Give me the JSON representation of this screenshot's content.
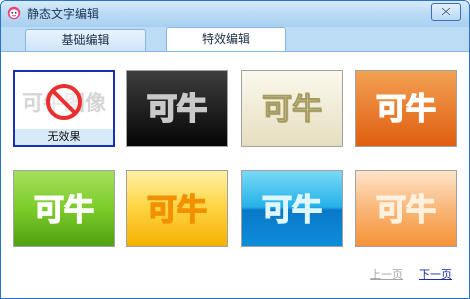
{
  "window": {
    "title": "静态文字编辑"
  },
  "tabs": [
    {
      "label": "基础编辑",
      "active": false
    },
    {
      "label": "特效编辑",
      "active": true
    }
  ],
  "effects": {
    "sample_text": "可牛",
    "noeffect_text": "可牛图像",
    "noeffect_label": "无效果",
    "items": [
      {
        "name": "no-effect",
        "selected": true
      },
      {
        "name": "black"
      },
      {
        "name": "cream"
      },
      {
        "name": "orange-red"
      },
      {
        "name": "green"
      },
      {
        "name": "yellow"
      },
      {
        "name": "aqua-blue"
      },
      {
        "name": "peach"
      }
    ]
  },
  "pager": {
    "prev": "上一页",
    "next": "下一页"
  },
  "colors": {
    "selected_border": "#1b2fb3",
    "title_bar": "#bcdcf6"
  }
}
